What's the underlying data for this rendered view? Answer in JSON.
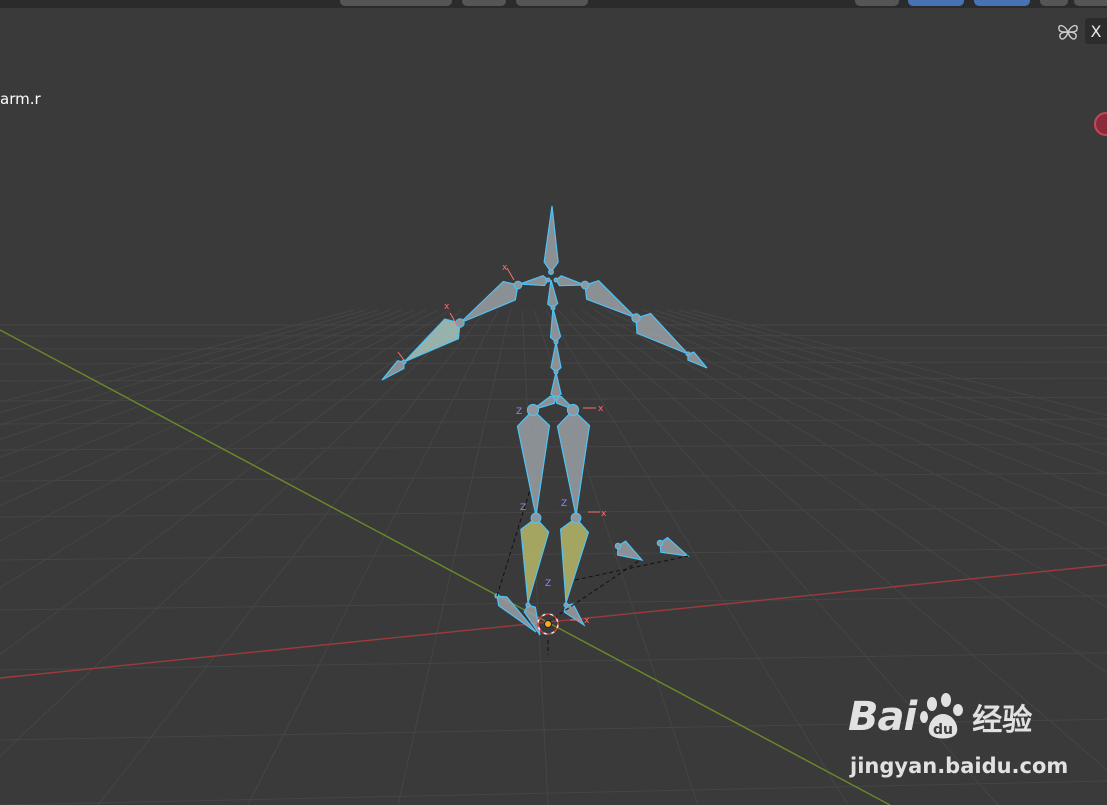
{
  "viewport": {
    "background": "#3a3a3a",
    "grid_color": "#454545",
    "x_axis_color": "#9c3b3b",
    "y_axis_color": "#6a8a2a",
    "bone_fill": "#9aa0a6",
    "bone_stroke": "#4fc3f7",
    "bone_ik_fill": "#b8b86a",
    "bone_active_fill": "#a8c8c0",
    "axis_x_letter": "x",
    "axis_z_letter": "Z"
  },
  "header": {
    "active_color": "#4772b3"
  },
  "overlay": {
    "object_label": "arm.r",
    "close_label": "X",
    "nav_icon": "butterfly-navigate-icon",
    "record_icon": "record-dot-icon"
  },
  "watermark": {
    "brand_left": "Bai",
    "brand_right": "经验",
    "url": "jingyan.baidu.com"
  }
}
